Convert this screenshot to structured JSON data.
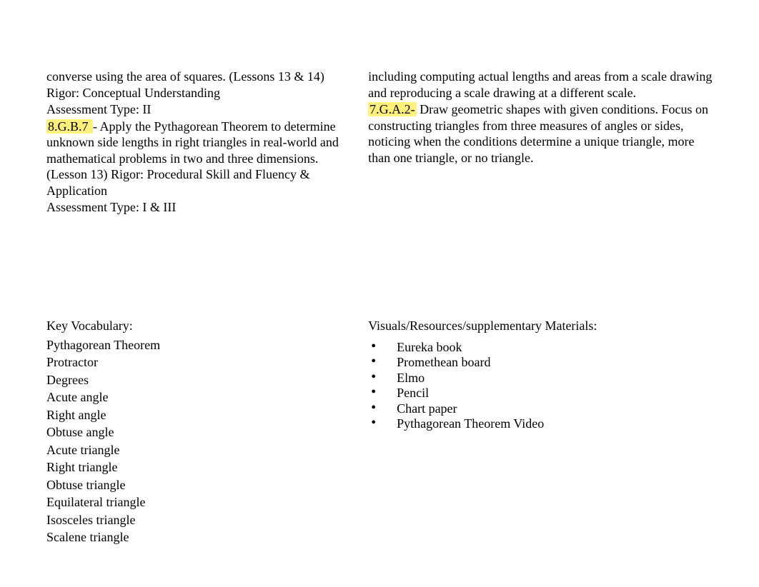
{
  "left_top": {
    "line1": "converse using the area of squares. (Lessons 13 & 14) Rigor: Conceptual Understanding",
    "line2": "Assessment Type: II",
    "standard_code": "8.G.B.7 ",
    "standard_text": "- Apply the Pythagorean Theorem to determine unknown side lengths in right triangles in real-world and mathematical problems in two and three dimensions. (Lesson 13) Rigor: Procedural Skill and Fluency & Application",
    "line4": "Assessment Type: I & III"
  },
  "right_top": {
    "line1": "including computing actual lengths and areas from a scale drawing and reproducing a scale drawing at a different scale.",
    "standard_code": "7.G.A.2-",
    "standard_text": " Draw geometric shapes with given conditions. Focus on constructing triangles from three measures of angles or sides, noticing when the conditions determine a unique triangle, more than one triangle, or no triangle."
  },
  "left_bottom": {
    "title": "Key Vocabulary:",
    "items": [
      "Pythagorean Theorem",
      "Protractor",
      " Degrees",
      "Acute angle",
      " Right angle",
      " Obtuse angle",
      " Acute triangle",
      " Right triangle",
      " Obtuse triangle  ",
      "Equilateral triangle",
      " Isosceles triangle",
      " Scalene triangle"
    ]
  },
  "right_bottom": {
    "title": "Visuals/Resources/supplementary Materials:",
    "items": [
      "Eureka book",
      "Promethean board",
      "Elmo",
      "Pencil",
      "Chart paper",
      "Pythagorean Theorem Video"
    ]
  }
}
